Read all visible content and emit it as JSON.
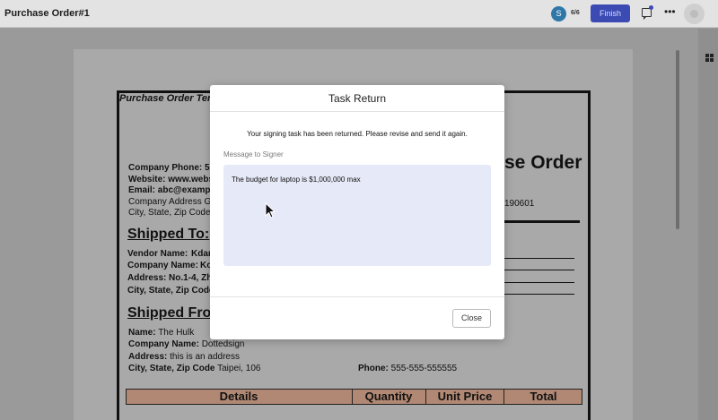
{
  "header": {
    "doc_title": "Purchase Order#1",
    "signer_initial": "S",
    "signer_count": "6/6",
    "finish_label": "Finish"
  },
  "icons": {
    "feedback": "feedback-icon",
    "more": "more-icon",
    "grid": "grid-icon"
  },
  "document": {
    "template_title": "Purchase Order Tem",
    "big_title": "se Order",
    "phone": "Company Phone: 555-",
    "website": "Website: www.websit",
    "email": "Email: abc@example.c",
    "address": "Company Address Goe",
    "city_state": "City, State, Zip Code",
    "po_number": "190601",
    "shipped_to": "Shipped To:",
    "vendor_name": "Vendor Name:",
    "vendor_value": "Kdar",
    "company_name_to": "Company Name:",
    "company_value_to": "Ko",
    "address_to": "Address:",
    "address_value_to": "No.1-4, Zh",
    "city_to": "City, State, Zip Code",
    "shipped_from": "Shipped Fro",
    "name_from_label": "Name:",
    "name_from_value": "The Hulk",
    "company_from_label": "Company Name:",
    "company_from_value": "Dottedsign",
    "address_from_label": "Address:",
    "address_from_value": "this is an address",
    "city_from_label": "City, State, Zip Code",
    "city_from_value": "Taipei, 106",
    "phone_from_label": "Phone:",
    "phone_from_value": "555-555-555555",
    "table_headers": [
      "Details",
      "Quantity",
      "Unit Price",
      "Total"
    ]
  },
  "modal": {
    "title": "Task Return",
    "message": "Your signing task has been returned. Please revise and send it again.",
    "label": "Message to Signer",
    "signer_message": "The budget for laptop is $1,000,000 max",
    "close_label": "Close"
  },
  "colors": {
    "finish_bg": "#3c4ab3",
    "message_box_bg": "#e6e9f7",
    "table_header_bg": "#b08873"
  }
}
